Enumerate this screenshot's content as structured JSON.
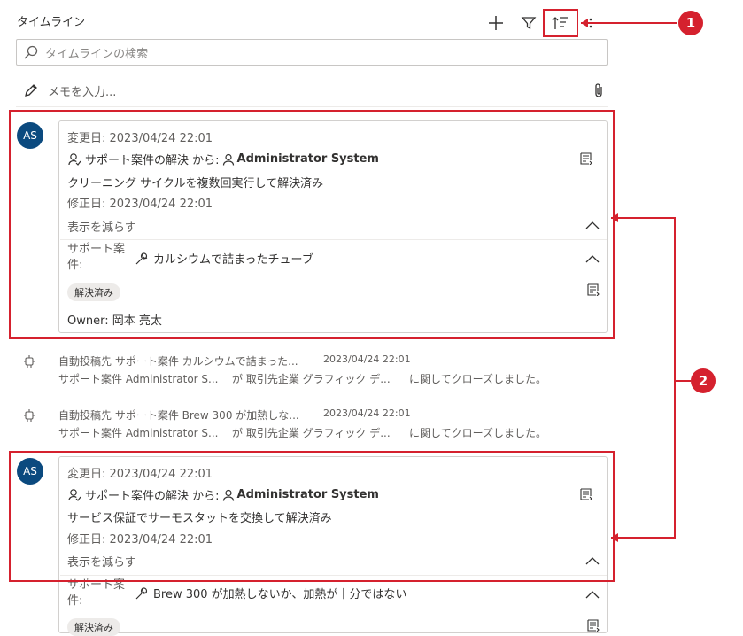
{
  "header": {
    "title": "タイムライン"
  },
  "search": {
    "placeholder": "タイムラインの検索"
  },
  "note": {
    "placeholder": "メモを入力..."
  },
  "post1": {
    "avatar": "AS",
    "changed": "変更日: 2023/04/24 22:01",
    "action": "サポート案件の解決 から:",
    "author": "Administrator System",
    "body": "クリーニング サイクルを複数回実行して解決済み",
    "modified": "修正日: 2023/04/24 22:01",
    "collapse_label": "表示を減らす",
    "case_label": "サポート案件:",
    "case_title": "カルシウムで詰まったチューブ",
    "status_badge": "解決済み",
    "owner": "Owner: 岡本 亮太"
  },
  "auto1": {
    "line1": "自動投稿先 サポート案件 カルシウムで詰まった...",
    "time": "2023/04/24 22:01",
    "line2_a": "サポート案件 Administrator S...",
    "line2_b": "が 取引先企業 グラフィック デ...",
    "line2_c": "に関してクローズしました。"
  },
  "auto2": {
    "line1": "自動投稿先 サポート案件 Brew 300 が加熱しな...",
    "time": "2023/04/24 22:01",
    "line2_a": "サポート案件 Administrator S...",
    "line2_b": "が 取引先企業 グラフィック デ...",
    "line2_c": "に関してクローズしました。"
  },
  "post2": {
    "avatar": "AS",
    "changed": "変更日: 2023/04/24 22:01",
    "action": "サポート案件の解決 から:",
    "author": "Administrator System",
    "body": "サービス保証でサーモスタットを交換して解決済み",
    "modified": "修正日: 2023/04/24 22:01",
    "collapse_label": "表示を減らす",
    "case_label": "サポート案件:",
    "case_title": "Brew 300 が加熱しないか、加熱が十分ではない",
    "status_badge": "解決済み"
  },
  "callouts": {
    "c1": "1",
    "c2": "2"
  },
  "colors": {
    "accent_red": "#d5212e",
    "avatar_blue": "#0b4a7f"
  }
}
